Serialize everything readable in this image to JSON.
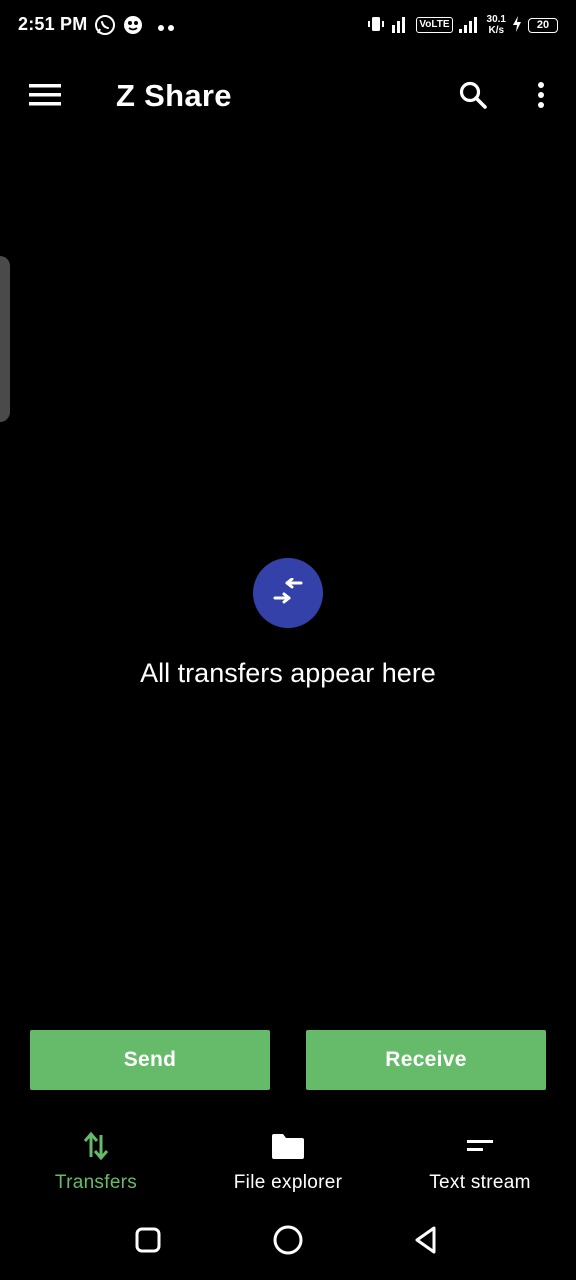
{
  "status_bar": {
    "time": "2:51 PM",
    "network_type": "VoLTE",
    "speed_value": "30.1",
    "speed_unit": "K/s",
    "battery": "20"
  },
  "app_bar": {
    "title": "Z Share",
    "menu_icon": "hamburger-menu-icon",
    "search_icon": "search-icon",
    "more_icon": "more-vert-icon"
  },
  "empty_state": {
    "icon": "transfer-arrows-icon",
    "message": "All transfers appear here"
  },
  "actions": {
    "send_label": "Send",
    "receive_label": "Receive"
  },
  "bottom_nav": {
    "items": [
      {
        "label": "Transfers",
        "icon": "transfers-icon",
        "active": true
      },
      {
        "label": "File explorer",
        "icon": "folder-icon",
        "active": false
      },
      {
        "label": "Text stream",
        "icon": "text-stream-icon",
        "active": false
      }
    ]
  },
  "colors": {
    "background": "#000000",
    "accent_green": "#66bb6a",
    "icon_circle_blue": "#3341a8",
    "text_primary": "#ffffff",
    "edge_handle": "#4a4a4a"
  }
}
